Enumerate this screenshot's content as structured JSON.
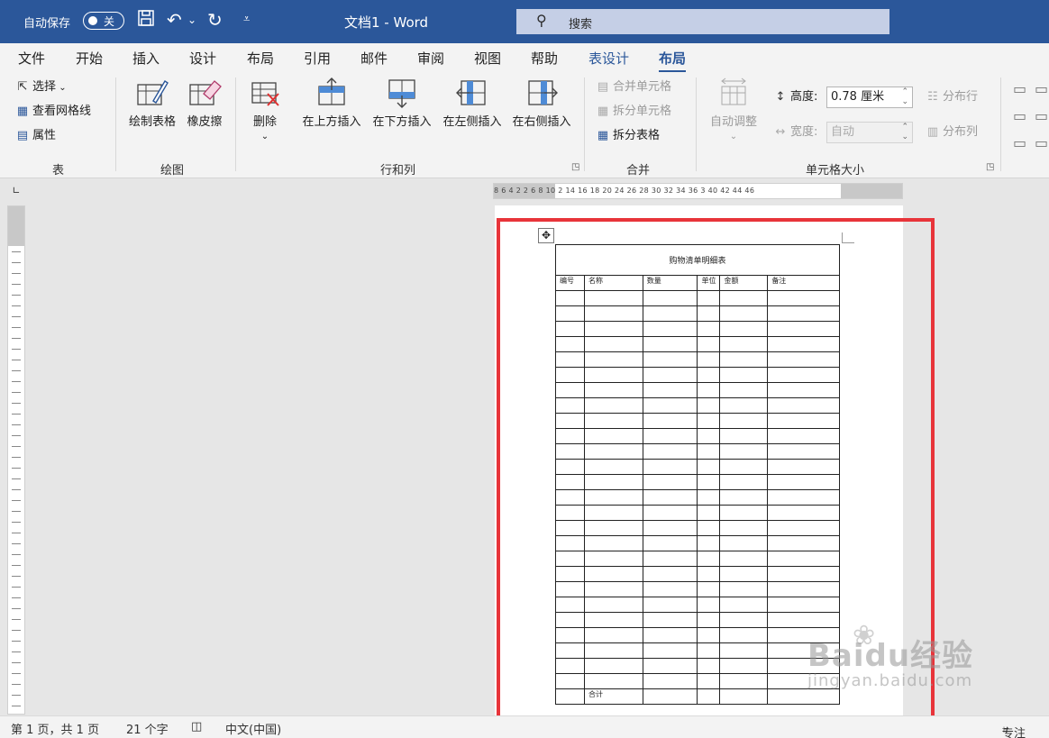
{
  "titlebar": {
    "autosave_label": "自动保存",
    "autosave_state": "关",
    "doc_title": "文档1  -  Word",
    "search_placeholder": "搜索",
    "accent_color": "#2b579a"
  },
  "tabs": [
    "文件",
    "开始",
    "插入",
    "设计",
    "布局",
    "引用",
    "邮件",
    "审阅",
    "视图",
    "帮助",
    "表设计",
    "布局"
  ],
  "ribbon": {
    "table_group": {
      "label": "表",
      "select": "选择",
      "gridlines": "查看网格线",
      "properties": "属性"
    },
    "draw_group": {
      "label": "绘图",
      "draw_table": "绘制表格",
      "eraser": "橡皮擦"
    },
    "rows_cols_group": {
      "label": "行和列",
      "delete": "删除",
      "insert_above": "在上方插入",
      "insert_below": "在下方插入",
      "insert_left": "在左侧插入",
      "insert_right": "在右侧插入"
    },
    "merge_group": {
      "label": "合并",
      "merge_cells": "合并单元格",
      "split_cells": "拆分单元格",
      "split_table": "拆分表格"
    },
    "cell_size_group": {
      "label": "单元格大小",
      "autofit": "自动调整",
      "height_label": "高度:",
      "height_value": "0.78 厘米",
      "width_label": "宽度:",
      "width_value": "自动",
      "distribute_rows": "分布行",
      "distribute_cols": "分布列"
    }
  },
  "ruler": {
    "numbers": "8  6  4  2      2     6  8  10    2  14  16  18    20    24  26  28    30  32  34  36  3    40  42  44  46"
  },
  "document": {
    "table_title": "购物清单明细表",
    "headers": [
      "编号",
      "名称",
      "数量",
      "单位",
      "金额",
      "备注"
    ],
    "empty_rows": 26,
    "total_label": "合计"
  },
  "watermark": {
    "logo": "Baidu经验",
    "url": "jingyan.baidu.com"
  },
  "statusbar": {
    "page": "第 1 页，共 1 页",
    "words": "21 个字",
    "language": "中文(中国)",
    "focus": "专注"
  }
}
